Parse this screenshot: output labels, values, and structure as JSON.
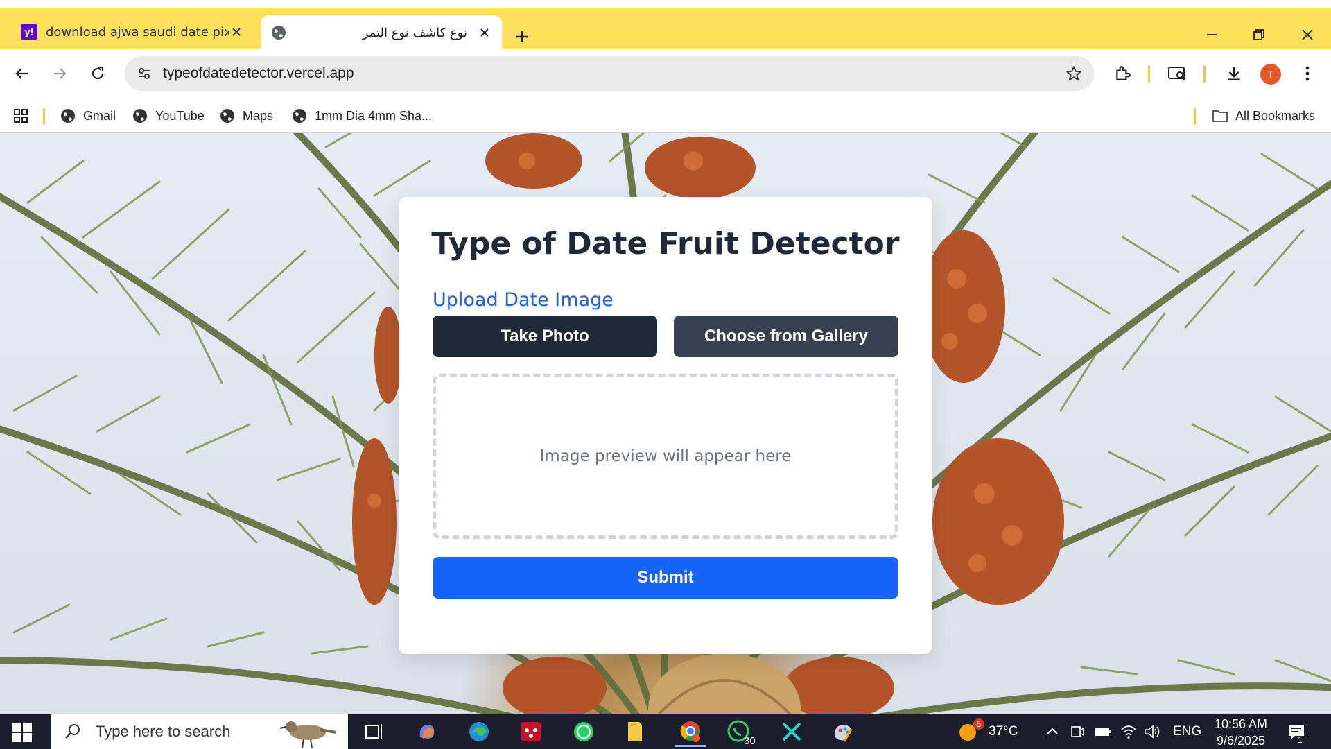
{
  "browser": {
    "tabs": [
      {
        "title": "download ajwa saudi date pixel",
        "favicon": "yahoo-icon",
        "active": false
      },
      {
        "title": "نوع كاشف نوع التمر",
        "favicon": "globe-icon",
        "active": true
      }
    ],
    "address": "typeofdatedetector.vercel.app",
    "profile_initial": "T",
    "bookmarks": [
      "Gmail",
      "YouTube",
      "Maps",
      "1mm Dia 4mm Sha..."
    ],
    "all_bookmarks": "All Bookmarks"
  },
  "app": {
    "title": "Type of Date Fruit Detector",
    "upload_label": "Upload Date Image",
    "take_photo": "Take Photo",
    "choose_gallery": "Choose from Gallery",
    "preview_placeholder": "Image preview will appear here",
    "submit": "Submit"
  },
  "taskbar": {
    "search_placeholder": "Type here to search",
    "whatsapp_badge": "30",
    "weather_badge": "5",
    "temperature": "37°C",
    "language": "ENG",
    "time": "10:56 AM",
    "date": "9/6/2025",
    "notification_count": "1"
  },
  "colors": {
    "tabstrip": "#fde05c",
    "primary_button": "#1f2937",
    "secondary_button": "#374151",
    "submit": "#1663f8",
    "link": "#1d5fe0"
  }
}
